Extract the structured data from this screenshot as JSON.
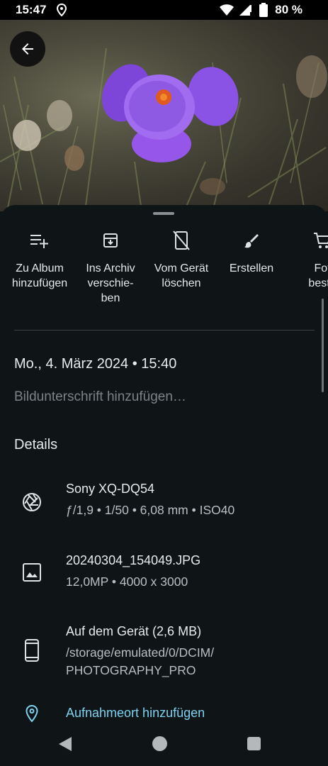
{
  "status_bar": {
    "time": "15:47",
    "battery": "80 %"
  },
  "actions": [
    {
      "label": "Zu Album\nhinzufügen",
      "icon": "playlist-add-icon"
    },
    {
      "label": "Ins Archiv\nverschie-\nben",
      "icon": "archive-icon"
    },
    {
      "label": "Vom Gerät\nlöschen",
      "icon": "delete-from-device-icon"
    },
    {
      "label": "Erstellen",
      "icon": "brush-icon"
    },
    {
      "label": "Fot\nbeste",
      "icon": "shopping-cart-icon"
    }
  ],
  "info": {
    "datetime": "Mo., 4. März 2024  •  15:40",
    "caption_placeholder": "Bildunterschrift hinzufügen…",
    "details_title": "Details"
  },
  "details": {
    "camera": {
      "title": "Sony XQ-DQ54",
      "sub": "ƒ/1,9  •  1/50  •  6,08 mm  •  ISO40",
      "icon": "camera-aperture-icon"
    },
    "file": {
      "title": "20240304_154049.JPG",
      "sub": "12,0MP  •  4000 x 3000",
      "icon": "image-icon"
    },
    "storage": {
      "title": "Auf dem Gerät (2,6 MB)",
      "path_line1": "/storage/emulated/0/DCIM/",
      "path_line2": "PHOTOGRAPHY_PRO",
      "icon": "phone-icon"
    },
    "location": {
      "label": "Aufnahmeort hinzufügen",
      "icon": "location-pin-icon"
    }
  },
  "colors": {
    "background": "#0f1417",
    "accent_link": "#7fd1f0",
    "flower": "#8b4ee0"
  }
}
